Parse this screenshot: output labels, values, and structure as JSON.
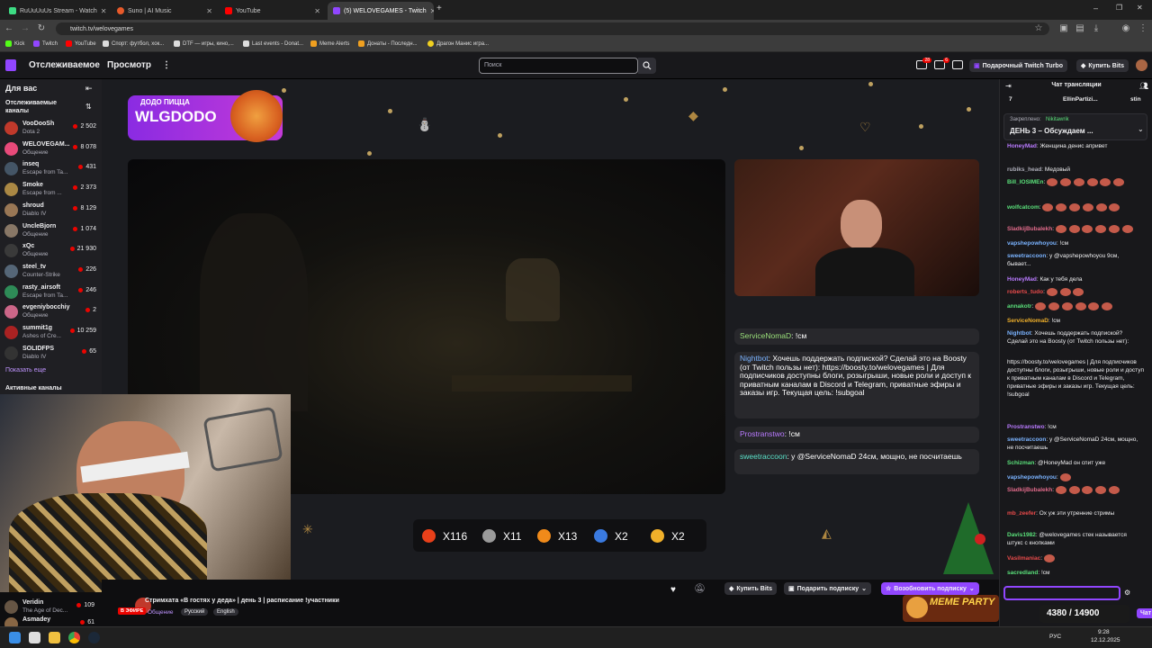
{
  "browser": {
    "tabs": [
      {
        "title": "RuUuUuUs Stream - Watch",
        "color": "#3ddc84"
      },
      {
        "title": "Suno | AI Music",
        "color": "#e85a2a"
      },
      {
        "title": "YouTube",
        "color": "#ff0000"
      },
      {
        "title": "(5) WELOVEGAMES - Twitch",
        "color": "#9146ff"
      }
    ],
    "url": "twitch.tv/welovegames",
    "bookmarks": [
      "Kick",
      "Twitch",
      "YouTube",
      "Спорт: футбол, хок...",
      "DTF — игры, кино,...",
      "Last events - Donat...",
      "Meme Alerts",
      "Донаты - Последн...",
      "Драгон Манис игра..."
    ]
  },
  "topnav": {
    "following": "Отслеживаемое",
    "browse": "Просмотр",
    "search_placeholder": "Поиск",
    "notif_badge_1": "28",
    "notif_badge_2": "6",
    "turbo": "Подарочный Twitch Turbo",
    "bits": "Купить Bits"
  },
  "sidebar": {
    "title": "Для вас",
    "section": "Отслеживаемые каналы",
    "channels": [
      {
        "name": "VooDooSh",
        "game": "Dota 2",
        "viewers": "2 502",
        "color": "#c0392b"
      },
      {
        "name": "WELOVEGAM...",
        "game": "Общение",
        "viewers": "8 078",
        "color": "#e84a7a"
      },
      {
        "name": "inseq",
        "game": "Escape from Ta...",
        "viewers": "431",
        "color": "#445566"
      },
      {
        "name": "Smoke",
        "game": "Escape from ...",
        "viewers": "2 373",
        "color": "#aa8844"
      },
      {
        "name": "shroud",
        "game": "Diablo IV",
        "viewers": "8 129",
        "color": "#997755"
      },
      {
        "name": "UncleBjorn",
        "game": "Общение",
        "viewers": "1 074",
        "color": "#887766"
      },
      {
        "name": "xQc",
        "game": "Общение",
        "viewers": "21 930",
        "color": "#3a3a3a"
      },
      {
        "name": "steel_tv",
        "game": "Counter-Strike",
        "viewers": "226",
        "color": "#556677"
      },
      {
        "name": "rasty_airsoft",
        "game": "Escape from Ta...",
        "viewers": "246",
        "color": "#2e8b57"
      },
      {
        "name": "evgeniybocchiy",
        "game": "Общение",
        "viewers": "2",
        "color": "#cc6688"
      },
      {
        "name": "summit1g",
        "game": "Ashes of Cre...",
        "viewers": "10 259",
        "color": "#aa2222"
      },
      {
        "name": "SOLIDFPS",
        "game": "Diablo IV",
        "viewers": "65",
        "color": "#333"
      }
    ],
    "show_more": "Показать еще",
    "active_channels": "Активные каналы",
    "extra_channels": [
      {
        "name": "Veridin",
        "game": "The Age of Dec...",
        "viewers": "109"
      },
      {
        "name": "Asmadey",
        "game": "",
        "viewers": "61"
      }
    ]
  },
  "stream": {
    "promo_brand": "ДОДО ПИЦЦА",
    "promo_code": "WLGDODO",
    "overlay_chat": [
      {
        "user": "ServiceNomaD",
        "text": ": !см",
        "color": "#9ae07a"
      },
      {
        "user": "Nightbot",
        "text": ": Хочешь поддержать подпиской? Сделай это на Boosty (от Twitch пользы нет): https://boosty.to/welovegames | Для подписчиков доступны блоги, розыгрыши, новые роли и доступ к приватным каналам в Discord и Telegram, приватные эфиры и заказы игр. Текущая цель: !subgoal",
        "color": "#7ab3ff"
      },
      {
        "user": "Prostranstwo",
        "text": ": !см",
        "color": "#b97aff"
      },
      {
        "user": "sweetraccoon",
        "text": ": у @ServiceNomaD 24см, мощно, не посчитаешь",
        "color": "#5ae0c8"
      }
    ],
    "overlay_chat_short": "ServiceNomaD: !см",
    "counters": [
      {
        "label": "X116",
        "color": "#e8401a"
      },
      {
        "label": "X11",
        "color": "#9a9a9a"
      },
      {
        "label": "X13",
        "color": "#f08a1a"
      },
      {
        "label": "X2",
        "color": "#3a7ae0"
      },
      {
        "label": "X2",
        "color": "#f0b02a"
      }
    ],
    "title": "Стримхата «В гостях у деда» | день 3 | расписание !участники",
    "live": "В ЭФИРЕ",
    "category": "Общение",
    "tags": [
      "Русский",
      "English"
    ],
    "actions": {
      "buy_bits": "Купить Bits",
      "gift_sub": "Подарить подписку",
      "resub": "Возобновить подписку"
    },
    "meme_party": "MEME PARTY",
    "meme_progress": "4380 / 14900"
  },
  "chat": {
    "title": "Чат трансляции",
    "pinned_label": "Закреплено:",
    "pinned_by": "Nikitawrik",
    "pinned_text": "ДЕНЬ 3 – Обсуждаем ...",
    "top_user": "EllinPartizi...",
    "top_user_2": "stin",
    "messages": [
      {
        "user": "HoneyMad",
        "text": ": Женщина денис апривет",
        "color": "#b97aff"
      },
      {
        "user": "rubiks_head",
        "text": ": Медовый",
        "color": "#adadb8"
      },
      {
        "user": "Bill_IOSIMEn",
        "text": ":",
        "color": "#5ae07a"
      },
      {
        "user": "wolfcatcom",
        "text": ":",
        "color": "#5ae07a"
      },
      {
        "user": "SladkijBubalekh",
        "text": ":",
        "color": "#e06a8a"
      },
      {
        "user": "vapshepowhoyou",
        "text": ": !см",
        "color": "#7ab3ff"
      },
      {
        "user": "sweetraccoon",
        "text": ": у @vapshepowhoyou 9см, бывает...",
        "color": "#7ab3ff"
      },
      {
        "user": "HoneyMad",
        "text": ": Как у тебя дела",
        "color": "#b97aff"
      },
      {
        "user": "roberts_tudo",
        "text": ":",
        "color": "#e84a4a"
      },
      {
        "user": "annakotr",
        "text": ":",
        "color": "#5ae07a"
      },
      {
        "user": "ServiceNomaD",
        "text": ": !см",
        "color": "#f0b02a"
      },
      {
        "user": "Nightbot",
        "text": ": Хочешь поддержать подпиской? Сделай это на Boosty (от Twitch пользы нет):",
        "color": "#7ab3ff"
      },
      {
        "user": "",
        "text": "https://boosty.to/welovegames | Для подписчиков доступны блоги, розыгрыши, новые роли и доступ к приватным каналам в Discord и Telegram, приватные эфиры и заказы игр. Текущая цель: !subgoal",
        "color": "#efeff1"
      },
      {
        "user": "Prostranstwo",
        "text": ": !см",
        "color": "#b97aff"
      },
      {
        "user": "sweetraccoon",
        "text": ": у @ServiceNomaD 24см, мощно, не посчитаешь",
        "color": "#7ab3ff"
      },
      {
        "user": "Schizman",
        "text": ": @HoneyMad он спит уже",
        "color": "#5ae07a"
      },
      {
        "user": "vapshepowhoyou",
        "text": ":",
        "color": "#7ab3ff"
      },
      {
        "user": "SladkijBubalekh",
        "text": ":",
        "color": "#e06a8a"
      },
      {
        "user": "mb_zeefer",
        "text": ": Ох уж эти утренние стримы",
        "color": "#e84a4a"
      },
      {
        "user": "Davis1982",
        "text": ": @welovegames стек называется штукс с кнопками",
        "color": "#5ae07a"
      },
      {
        "user": "Vasilmaniac",
        "text": ":",
        "color": "#e84a4a"
      },
      {
        "user": "sacredland",
        "text": ": !см",
        "color": "#5ae07a"
      }
    ],
    "send": "Чат"
  },
  "taskbar": {
    "lang": "РУС",
    "time": "9:28",
    "date": "12.12.2025"
  }
}
